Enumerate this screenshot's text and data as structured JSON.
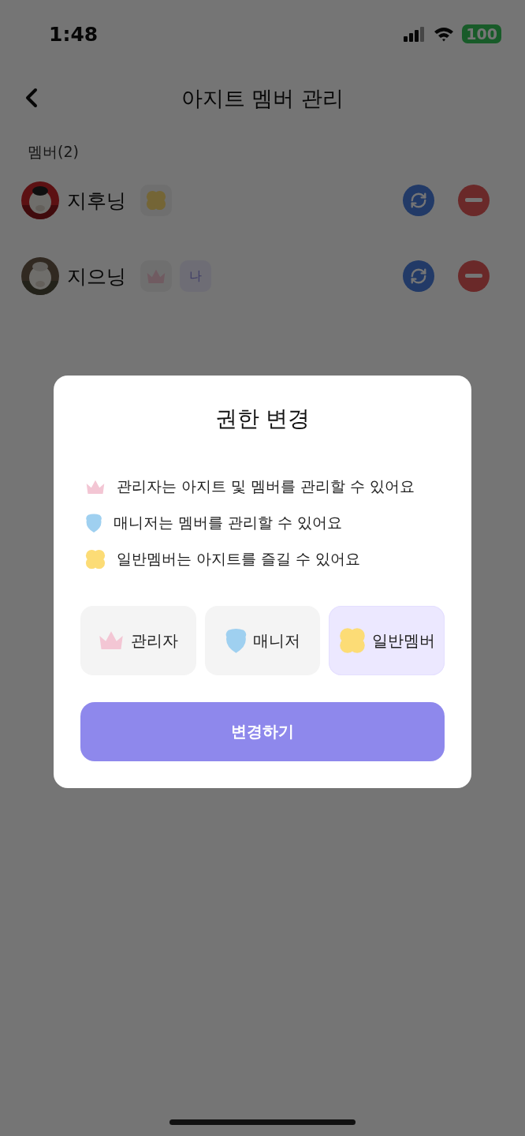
{
  "status_bar": {
    "time": "1:48",
    "battery": "100"
  },
  "header": {
    "title": "아지트 멤버 관리"
  },
  "members_label": "멤버(2)",
  "members": [
    {
      "name": "지후닝",
      "kind": "member"
    },
    {
      "name": "지으닝",
      "kind": "admin",
      "badges": [
        "나"
      ]
    }
  ],
  "dialog": {
    "title": "권한 변경",
    "descriptions": [
      {
        "kind": "admin",
        "text": "관리자는 아지트 및 멤버를 관리할 수 있어요"
      },
      {
        "kind": "manager",
        "text": "매니저는 멤버를 관리할 수 있어요"
      },
      {
        "kind": "member",
        "text": "일반멤버는 아지트를 즐길 수 있어요"
      }
    ],
    "options": [
      {
        "kind": "admin",
        "label": "관리자",
        "selected": false
      },
      {
        "kind": "manager",
        "label": "매니저",
        "selected": false
      },
      {
        "kind": "member",
        "label": "일반멤버",
        "selected": true
      }
    ],
    "confirm": "변경하기"
  }
}
